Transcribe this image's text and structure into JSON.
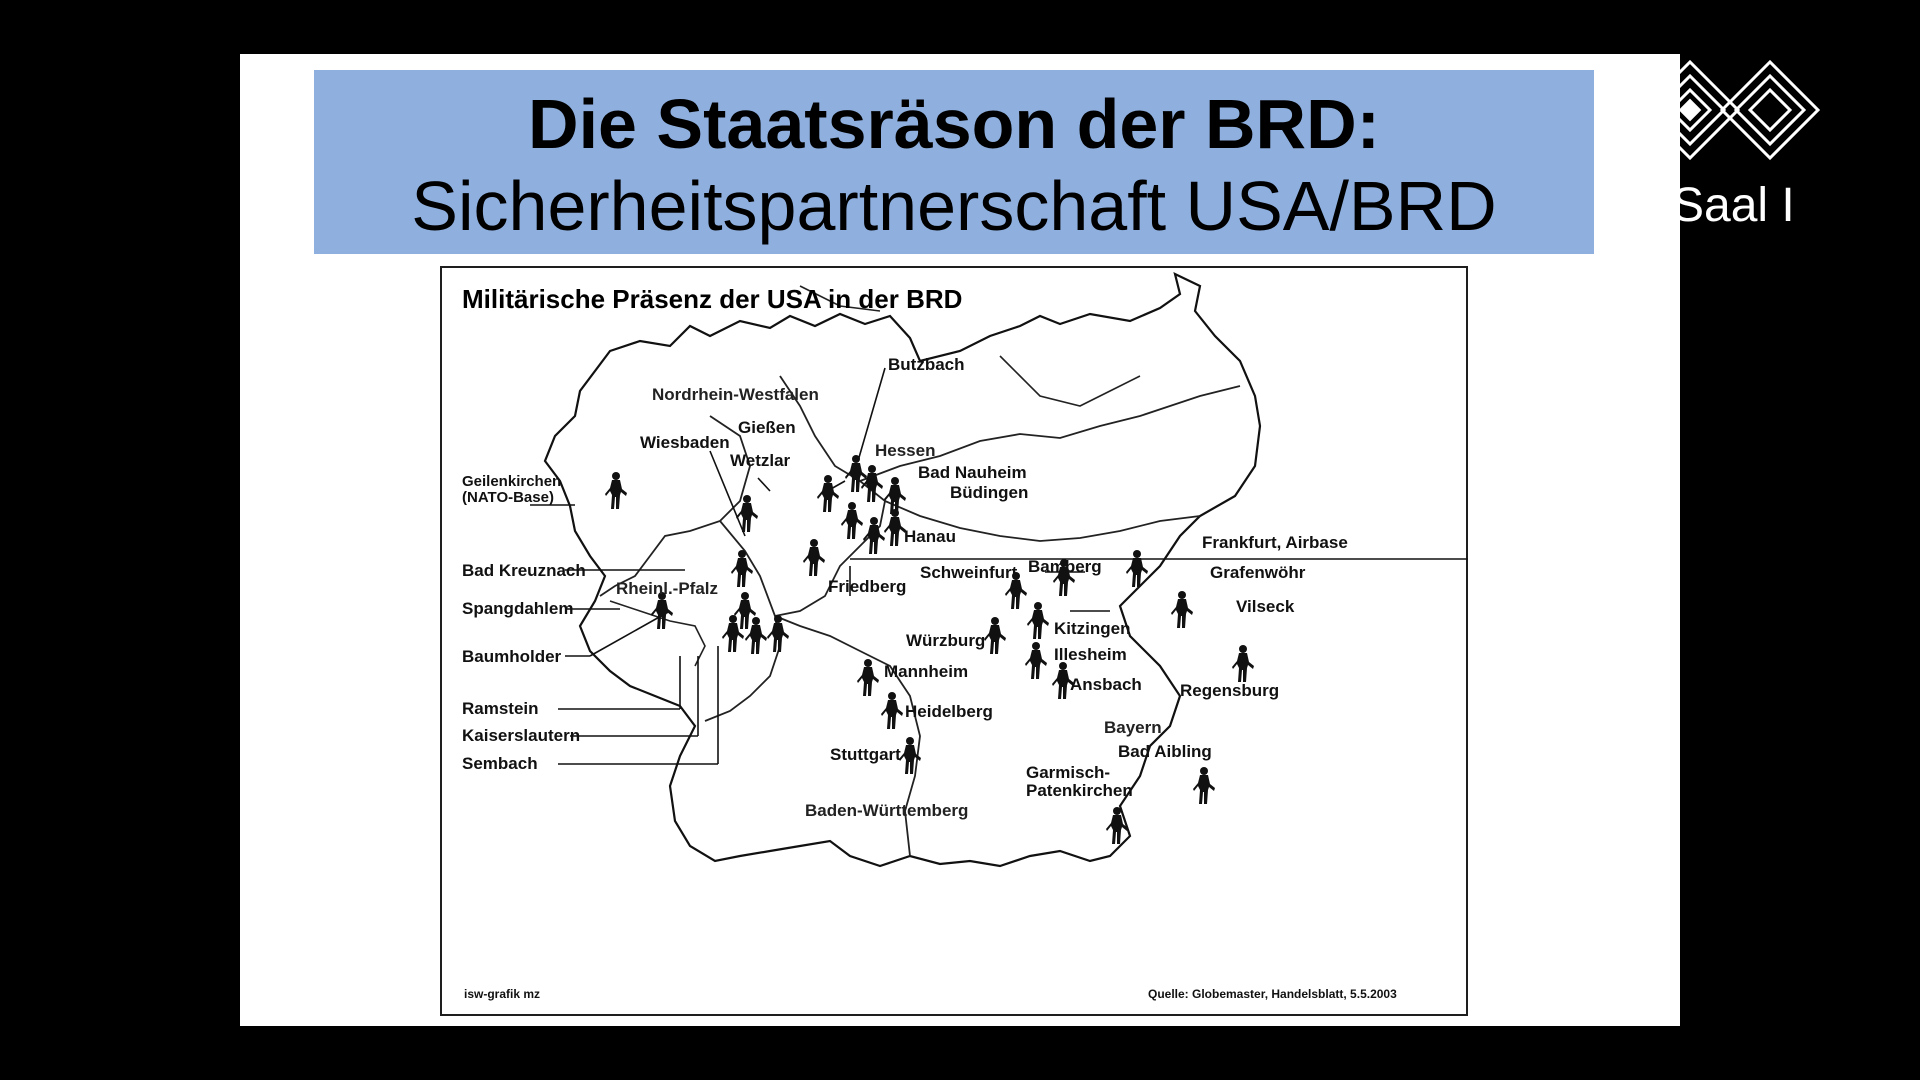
{
  "slide": {
    "title_line1": "Die Staatsräson der BRD:",
    "title_line2": "Sicherheitspartnerschaft USA/BRD",
    "title_bg_color": "#8fb0df"
  },
  "overlay": {
    "logo_icon": "cube-logo-icon",
    "logo_text": "Saal I"
  },
  "map": {
    "heading": "Militärische Präsenz der USA in der BRD",
    "credit": "isw-grafik mz",
    "source": "Quelle: Globemaster, Handelsblatt, 5.5.2003",
    "marker_icon": "soldier-icon",
    "states": {
      "nrw": "Nordrhein-Westfalen",
      "hessen": "Hessen",
      "rlp": "Rheinl.-Pfalz",
      "bw": "Baden-Württemberg",
      "bayern": "Bayern"
    },
    "locations": {
      "geilenkirchen": "Geilenkirchen",
      "nato_base": "(NATO-Base)",
      "bad_kreuznach": "Bad Kreuznach",
      "spangdahlem": "Spangdahlem",
      "baumholder": "Baumholder",
      "ramstein": "Ramstein",
      "kaiserslautern": "Kaiserslautern",
      "sembach": "Sembach",
      "butzbach": "Butzbach",
      "giessen": "Gießen",
      "wiesbaden": "Wiesbaden",
      "wetzlar": "Wetzlar",
      "bad_nauheim": "Bad Nauheim",
      "buedingen": "Büdingen",
      "hanau": "Hanau",
      "friedberg": "Friedberg",
      "frankfurt": "Frankfurt, Airbase",
      "schweinfurt": "Schweinfurt",
      "bamberg": "Bamberg",
      "grafenwoehr": "Grafenwöhr",
      "vilseck": "Vilseck",
      "wuerzburg": "Würzburg",
      "kitzingen": "Kitzingen",
      "illesheim": "Illesheim",
      "ansbach": "Ansbach",
      "mannheim": "Mannheim",
      "heidelberg": "Heidelberg",
      "regensburg": "Regensburg",
      "stuttgart": "Stuttgart",
      "bad_aibling": "Bad Aibling",
      "garmisch1": "Garmisch-",
      "garmisch2": "Patenkirchen"
    }
  }
}
